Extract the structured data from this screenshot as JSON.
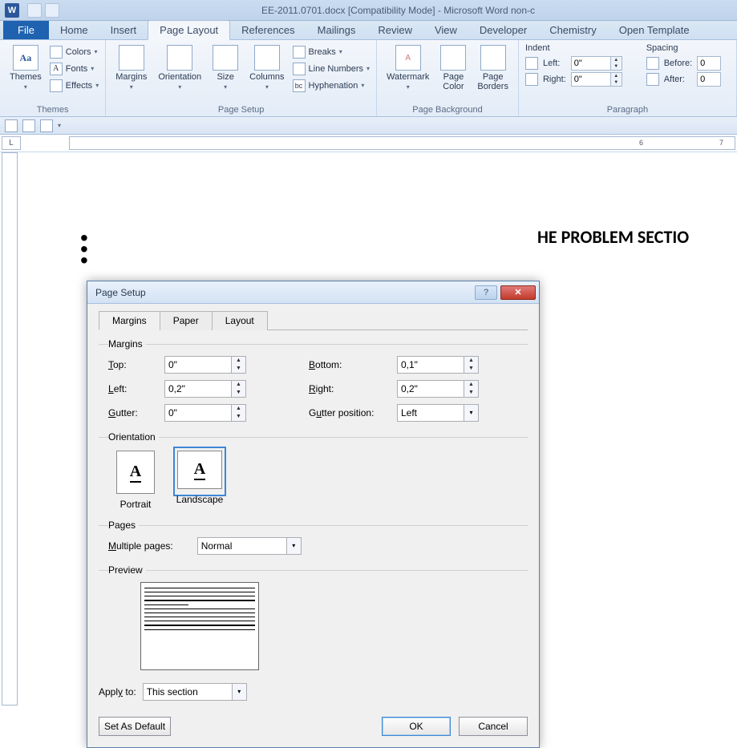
{
  "titlebar": {
    "title": "EE-2011.0701.docx [Compatibility Mode] - Microsoft Word non-c"
  },
  "tabs": {
    "file": "File",
    "items": [
      "Home",
      "Insert",
      "Page Layout",
      "References",
      "Mailings",
      "Review",
      "View",
      "Developer",
      "Chemistry",
      "Open Template"
    ],
    "active": "Page Layout"
  },
  "ribbon": {
    "themes": {
      "label": "Themes",
      "themes_btn": "Themes",
      "colors": "Colors",
      "fonts": "Fonts",
      "effects": "Effects"
    },
    "page_setup": {
      "label": "Page Setup",
      "margins": "Margins",
      "orientation": "Orientation",
      "size": "Size",
      "columns": "Columns",
      "breaks": "Breaks",
      "line_numbers": "Line Numbers",
      "hyphenation": "Hyphenation"
    },
    "background": {
      "label": "Page Background",
      "watermark": "Watermark",
      "page_color": "Page\nColor",
      "page_borders": "Page\nBorders"
    },
    "paragraph": {
      "label": "Paragraph",
      "indent_title": "Indent",
      "spacing_title": "Spacing",
      "left_label": "Left:",
      "right_label": "Right:",
      "before_label": "Before:",
      "after_label": "After:",
      "left_val": "0\"",
      "right_val": "0\"",
      "before_val": "0",
      "after_val": "0"
    }
  },
  "ruler": {
    "corner": "L",
    "nums": [
      "6",
      "7"
    ]
  },
  "document": {
    "heading": "HE PROBLEM SECTIO"
  },
  "dialog": {
    "title": "Page Setup",
    "tabs": {
      "margins": "Margins",
      "paper": "Paper",
      "layout": "Layout",
      "active": "Margins"
    },
    "margins": {
      "section": "Margins",
      "top_label": "Top:",
      "top_val": "0\"",
      "bottom_label": "Bottom:",
      "bottom_val": "0,1\"",
      "left_label": "Left:",
      "left_val": "0,2\"",
      "right_label": "Right:",
      "right_val": "0,2\"",
      "gutter_label": "Gutter:",
      "gutter_val": "0\"",
      "gutter_pos_label": "Gutter position:",
      "gutter_pos_val": "Left"
    },
    "orientation": {
      "section": "Orientation",
      "portrait": "Portrait",
      "landscape": "Landscape",
      "selected": "Landscape"
    },
    "pages": {
      "section": "Pages",
      "multiple_label": "Multiple pages:",
      "multiple_val": "Normal"
    },
    "preview": {
      "section": "Preview"
    },
    "apply": {
      "label": "Apply to:",
      "value": "This section"
    },
    "buttons": {
      "default": "Set As Default",
      "ok": "OK",
      "cancel": "Cancel"
    }
  }
}
